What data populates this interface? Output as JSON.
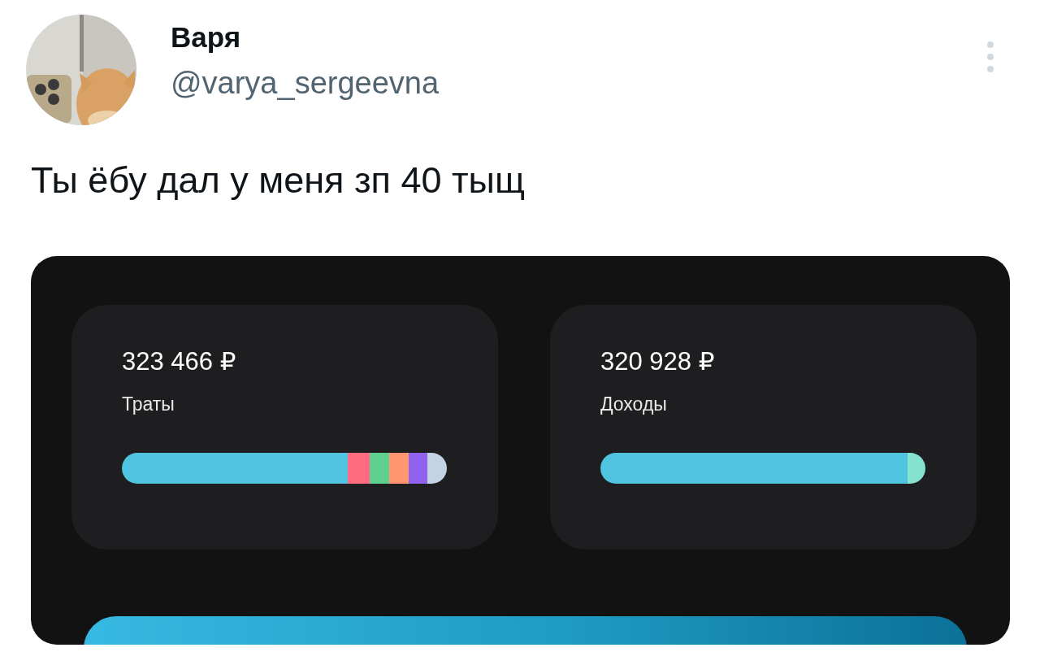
{
  "tweet": {
    "author": {
      "name": "Варя",
      "handle": "@varya_sergeevna"
    },
    "text": "Ты ёбу дал у меня зп 40 тыщ"
  },
  "attachment": {
    "kind": "screenshot",
    "cards": [
      {
        "kind": "expenses",
        "amount": "323 466 ₽",
        "label": "Траты"
      },
      {
        "kind": "income",
        "amount": "320 928 ₽",
        "label": "Доходы"
      }
    ]
  }
}
